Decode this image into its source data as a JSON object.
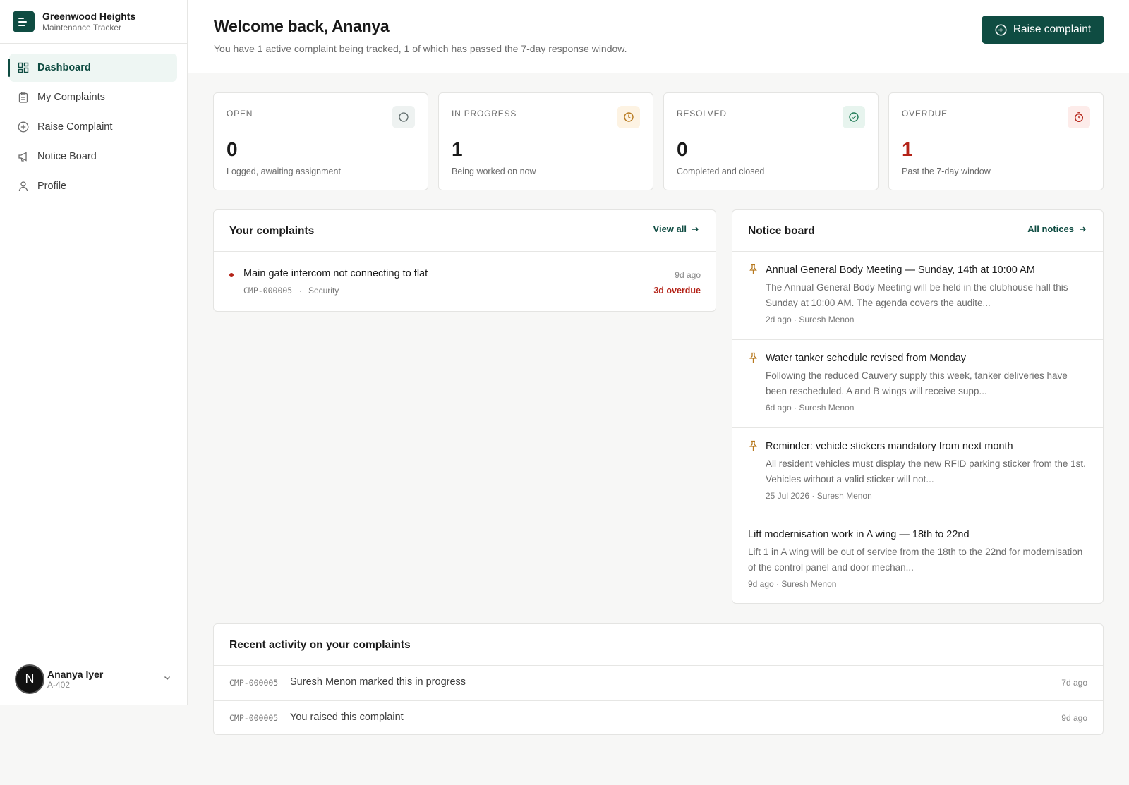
{
  "brand": {
    "name": "Greenwood Heights",
    "subtitle": "Maintenance Tracker"
  },
  "nav": [
    {
      "label": "Dashboard",
      "icon": "dashboard-icon",
      "active": true
    },
    {
      "label": "My Complaints",
      "icon": "clipboard-icon"
    },
    {
      "label": "Raise Complaint",
      "icon": "plus-circle-icon"
    },
    {
      "label": "Notice Board",
      "icon": "megaphone-icon"
    },
    {
      "label": "Profile",
      "icon": "user-icon"
    }
  ],
  "user": {
    "initial": "N",
    "name": "Ananya Iyer",
    "flat": "A-402"
  },
  "header": {
    "title": "Welcome back, Ananya",
    "subtitle": "You have 1 active complaint being tracked, 1 of which has passed the 7-day response window.",
    "raise_button": "Raise complaint"
  },
  "stats": [
    {
      "label": "OPEN",
      "value": "0",
      "desc": "Logged, awaiting assignment",
      "icon": "circle-icon",
      "color": "#5f6b6b"
    },
    {
      "label": "IN PROGRESS",
      "value": "1",
      "desc": "Being worked on now",
      "icon": "clock-icon",
      "color": "#b7791f"
    },
    {
      "label": "RESOLVED",
      "value": "0",
      "desc": "Completed and closed",
      "icon": "check-circle-icon",
      "color": "#1f7a55"
    },
    {
      "label": "OVERDUE",
      "value": "1",
      "desc": "Past the 7-day window",
      "icon": "timer-icon",
      "color": "#b42318"
    }
  ],
  "complaints_panel": {
    "title": "Your complaints",
    "link": "View all",
    "items": [
      {
        "title": "Main gate intercom not connecting to flat",
        "id": "CMP-000005",
        "sep": "·",
        "category": "Security",
        "age": "9d ago",
        "overdue": "3d overdue"
      }
    ]
  },
  "notice_panel": {
    "title": "Notice board",
    "link": "All notices",
    "items": [
      {
        "pinned": true,
        "title": "Annual General Body Meeting — Sunday, 14th at 10:00 AM",
        "body": "The Annual General Body Meeting will be held in the clubhouse hall this Sunday at 10:00 AM. The agenda covers the audite...",
        "meta": "2d ago · Suresh Menon"
      },
      {
        "pinned": true,
        "title": "Water tanker schedule revised from Monday",
        "body": "Following the reduced Cauvery supply this week, tanker deliveries have been rescheduled. A and B wings will receive supp...",
        "meta": "6d ago · Suresh Menon"
      },
      {
        "pinned": true,
        "title": "Reminder: vehicle stickers mandatory from next month",
        "body": "All resident vehicles must display the new RFID parking sticker from the 1st. Vehicles without a valid sticker will not...",
        "meta": "25 Jul 2026 · Suresh Menon"
      },
      {
        "pinned": false,
        "title": "Lift modernisation work in A wing — 18th to 22nd",
        "body": "Lift 1 in A wing will be out of service from the 18th to the 22nd for modernisation of the control panel and door mechan...",
        "meta": "9d ago · Suresh Menon"
      }
    ]
  },
  "activity_panel": {
    "title": "Recent activity on your complaints",
    "items": [
      {
        "id": "CMP-000005",
        "text": "Suresh Menon marked this in progress",
        "age": "7d ago"
      },
      {
        "id": "CMP-000005",
        "text": "You raised this complaint",
        "age": "9d ago"
      }
    ]
  },
  "colors": {
    "brand": "#0f4c42",
    "danger": "#b42318",
    "pin": "#b7791f"
  }
}
